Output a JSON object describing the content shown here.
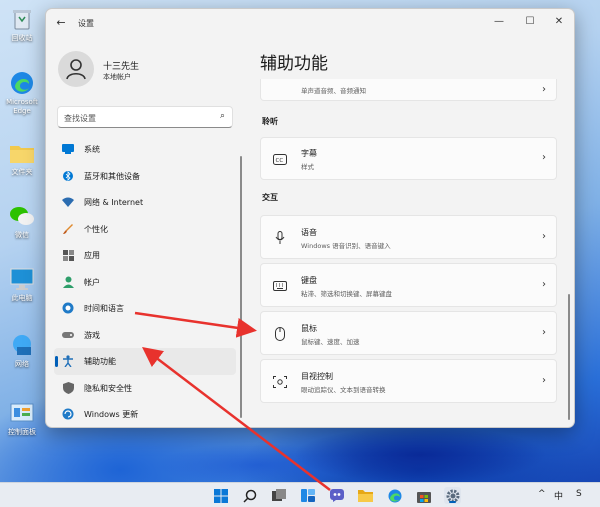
{
  "desktop": {
    "icons": [
      {
        "label": "回收站",
        "icon": "recycle-bin-icon"
      },
      {
        "label": "Microsoft Edge",
        "icon": "edge-icon"
      },
      {
        "label": "文件夹",
        "icon": "folder-icon"
      },
      {
        "label": "微信",
        "icon": "wechat-icon"
      },
      {
        "label": "此电脑",
        "icon": "this-pc-icon"
      },
      {
        "label": "网络",
        "icon": "network-icon"
      },
      {
        "label": "控制面板",
        "icon": "control-panel-icon"
      }
    ]
  },
  "window": {
    "title": "设置",
    "back_icon": "back-arrow-icon",
    "controls": [
      "minimize-icon",
      "maximize-icon",
      "close-icon"
    ]
  },
  "profile": {
    "name": "十三先生",
    "subtitle": "本地帐户"
  },
  "search": {
    "placeholder": "查找设置",
    "icon": "search-icon"
  },
  "sidebar": {
    "items": [
      {
        "label": "系统",
        "icon": "system-icon",
        "color": "#0078d4"
      },
      {
        "label": "蓝牙和其他设备",
        "icon": "bluetooth-icon",
        "color": "#0078d4"
      },
      {
        "label": "网络 & Internet",
        "icon": "wifi-icon",
        "color": "#2b6cb0"
      },
      {
        "label": "个性化",
        "icon": "brush-icon",
        "color": "#e08a2e"
      },
      {
        "label": "应用",
        "icon": "apps-icon",
        "color": "#555555"
      },
      {
        "label": "帐户",
        "icon": "account-icon",
        "color": "#2e9e6a"
      },
      {
        "label": "时间和语言",
        "icon": "globe-clock-icon",
        "color": "#1f7ac7"
      },
      {
        "label": "游戏",
        "icon": "gamepad-icon",
        "color": "#777777"
      },
      {
        "label": "辅助功能",
        "icon": "accessibility-icon",
        "color": "#1f6fb8",
        "active": true
      },
      {
        "label": "隐私和安全性",
        "icon": "shield-icon",
        "color": "#666666"
      },
      {
        "label": "Windows 更新",
        "icon": "update-icon",
        "color": "#1f7ac7"
      }
    ]
  },
  "main": {
    "title": "辅助功能",
    "top_card": {
      "subtitle": "单声道音频、音频通知"
    },
    "sections": [
      {
        "label": "聆听",
        "cards": [
          {
            "title": "字幕",
            "subtitle": "样式",
            "icon": "captions-icon"
          }
        ]
      },
      {
        "label": "交互",
        "cards": [
          {
            "title": "语音",
            "subtitle": "Windows 语音识别、语音键入",
            "icon": "microphone-icon"
          },
          {
            "title": "键盘",
            "subtitle": "粘滞、筛选和切换键、屏幕键盘",
            "icon": "keyboard-icon"
          },
          {
            "title": "鼠标",
            "subtitle": "鼠标键、速度、加速",
            "icon": "mouse-icon"
          },
          {
            "title": "目视控制",
            "subtitle": "眼动追踪仪、文本到语音转换",
            "icon": "eye-control-icon"
          }
        ]
      }
    ]
  },
  "taskbar": {
    "icons": [
      "start-icon",
      "search-icon",
      "task-view-icon",
      "widgets-icon",
      "teams-chat-icon",
      "file-explorer-icon",
      "edge-icon",
      "store-icon",
      "settings-icon"
    ],
    "tray": {
      "chevron": "^",
      "ime": "中",
      "lang": "S"
    }
  },
  "annotations": {
    "arrow_color": "#e8322d"
  }
}
